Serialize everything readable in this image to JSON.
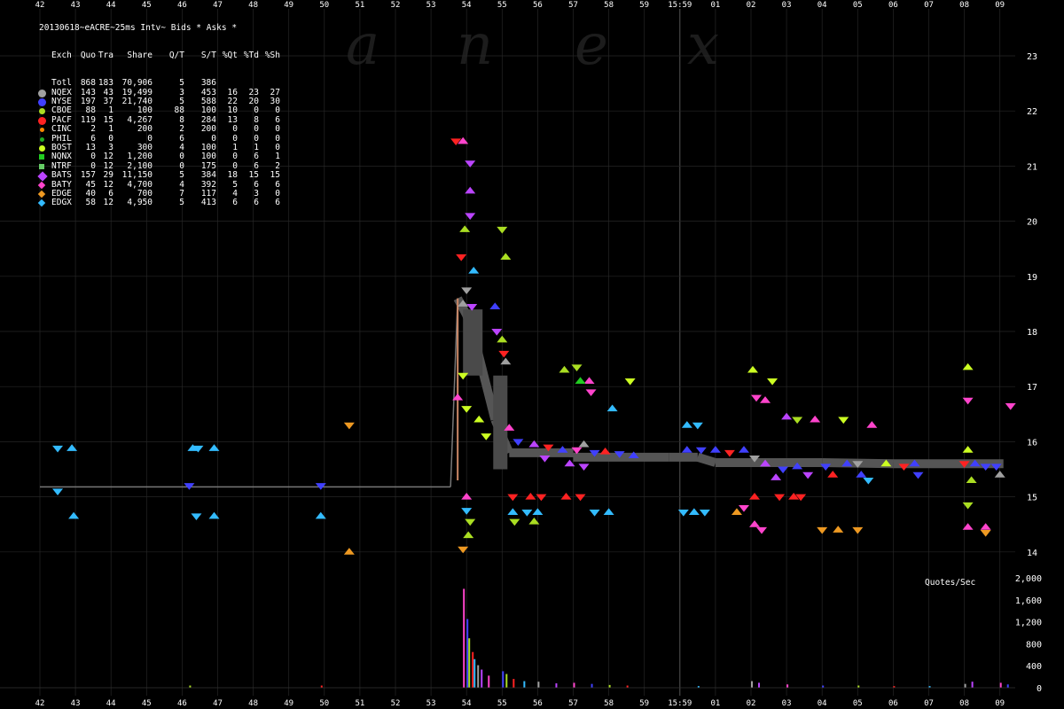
{
  "header": {
    "line1": "20130618~eACRE~25ms Intv~ Bids * Asks *",
    "columns": [
      "Exch",
      "Quo",
      "Tra",
      "Share",
      "Q/T",
      "S/T",
      "%Qt",
      "%Td",
      "%Sh"
    ]
  },
  "stats_rows": [
    {
      "exch": "Totl",
      "quo": "868",
      "tra": "183",
      "share": "70,906",
      "qt": "5",
      "st": "386",
      "pqt": "",
      "ptd": "",
      "psh": "",
      "color": "",
      "shape": "none"
    },
    {
      "exch": "NQEX",
      "quo": "143",
      "tra": "43",
      "share": "19,499",
      "qt": "3",
      "st": "453",
      "pqt": "16",
      "ptd": "23",
      "psh": "27",
      "color": "#a0a0a0",
      "shape": "hex"
    },
    {
      "exch": "NYSE",
      "quo": "197",
      "tra": "37",
      "share": "21,740",
      "qt": "5",
      "st": "588",
      "pqt": "22",
      "ptd": "20",
      "psh": "30",
      "color": "#4040ff",
      "shape": "hex"
    },
    {
      "exch": "CBOE",
      "quo": "88",
      "tra": "1",
      "share": "100",
      "qt": "88",
      "st": "100",
      "pqt": "10",
      "ptd": "0",
      "psh": "0",
      "color": "#aadd22",
      "shape": "dot"
    },
    {
      "exch": "PACF",
      "quo": "119",
      "tra": "15",
      "share": "4,267",
      "qt": "8",
      "st": "284",
      "pqt": "13",
      "ptd": "8",
      "psh": "6",
      "color": "#ff2222",
      "shape": "dotbig"
    },
    {
      "exch": "CINC",
      "quo": "2",
      "tra": "1",
      "share": "200",
      "qt": "2",
      "st": "200",
      "pqt": "0",
      "ptd": "0",
      "psh": "0",
      "color": "#ff8800",
      "shape": "dotsmall"
    },
    {
      "exch": "PHIL",
      "quo": "6",
      "tra": "0",
      "share": "0",
      "qt": "6",
      "st": "0",
      "pqt": "0",
      "ptd": "0",
      "psh": "0",
      "color": "#22aa22",
      "shape": "dotsmall"
    },
    {
      "exch": "BOST",
      "quo": "13",
      "tra": "3",
      "share": "300",
      "qt": "4",
      "st": "100",
      "pqt": "1",
      "ptd": "1",
      "psh": "0",
      "color": "#ccff22",
      "shape": "dot"
    },
    {
      "exch": "NQNX",
      "quo": "0",
      "tra": "12",
      "share": "1,200",
      "qt": "0",
      "st": "100",
      "pqt": "0",
      "ptd": "6",
      "psh": "1",
      "color": "#22cc22",
      "shape": "square"
    },
    {
      "exch": "NTRF",
      "quo": "0",
      "tra": "12",
      "share": "2,100",
      "qt": "0",
      "st": "175",
      "pqt": "0",
      "ptd": "6",
      "psh": "2",
      "color": "#66cc66",
      "shape": "square"
    },
    {
      "exch": "BATS",
      "quo": "157",
      "tra": "29",
      "share": "11,150",
      "qt": "5",
      "st": "384",
      "pqt": "18",
      "ptd": "15",
      "psh": "15",
      "color": "#bb44ff",
      "shape": "diamond"
    },
    {
      "exch": "BATY",
      "quo": "45",
      "tra": "12",
      "share": "4,700",
      "qt": "4",
      "st": "392",
      "pqt": "5",
      "ptd": "6",
      "psh": "6",
      "color": "#ff44cc",
      "shape": "diamondsmall"
    },
    {
      "exch": "EDGE",
      "quo": "40",
      "tra": "6",
      "share": "700",
      "qt": "7",
      "st": "117",
      "pqt": "4",
      "ptd": "3",
      "psh": "0",
      "color": "#ee9922",
      "shape": "diamondsmall"
    },
    {
      "exch": "EDGX",
      "quo": "58",
      "tra": "12",
      "share": "4,950",
      "qt": "5",
      "st": "413",
      "pqt": "6",
      "ptd": "6",
      "psh": "6",
      "color": "#33bbff",
      "shape": "diamondsmall"
    }
  ],
  "watermark": [
    "a",
    "n",
    "e",
    "x"
  ],
  "chart_data": {
    "type": "scatter",
    "x_ticks": [
      "42",
      "43",
      "44",
      "45",
      "46",
      "47",
      "48",
      "49",
      "50",
      "51",
      "52",
      "53",
      "54",
      "55",
      "56",
      "57",
      "58",
      "59",
      "15:59",
      "01",
      "02",
      "03",
      "04",
      "05",
      "06",
      "07",
      "08",
      "09"
    ],
    "y_ticks": [
      14,
      15,
      16,
      17,
      18,
      19,
      20,
      21,
      22,
      23
    ],
    "ylim": [
      13.6,
      23.8
    ],
    "volume_label": "Quotes/Sec",
    "volume_ticks": [
      0,
      400,
      800,
      1200,
      1600,
      2000
    ],
    "volume_ylim": [
      0,
      2100
    ],
    "nbbo": [
      {
        "x": 42.0,
        "y": 15.18
      },
      {
        "x": 53.55,
        "y": 15.18
      },
      {
        "x": 53.75,
        "y": 18.6
      },
      {
        "x": 54.0,
        "y": 18.3
      },
      {
        "x": 54.25,
        "y": 17.8
      },
      {
        "x": 54.8,
        "y": 16.4
      },
      {
        "x": 55.2,
        "y": 15.8
      },
      {
        "x": 57.0,
        "y": 15.8
      },
      {
        "x": 57.0,
        "y": 15.72
      },
      {
        "x": 59.7,
        "y": 15.72
      },
      {
        "x": 60.5,
        "y": 15.72
      },
      {
        "x": 61.0,
        "y": 15.62
      },
      {
        "x": 64.0,
        "y": 15.62
      },
      {
        "x": 66.0,
        "y": 15.6
      },
      {
        "x": 69.1,
        "y": 15.6
      }
    ],
    "quotes": [
      {
        "x": 42.5,
        "y": 15.88,
        "ex": "EDGX"
      },
      {
        "x": 42.9,
        "y": 15.88,
        "ex": "EDGX"
      },
      {
        "x": 42.5,
        "y": 15.1,
        "ex": "EDGX"
      },
      {
        "x": 42.95,
        "y": 14.65,
        "ex": "EDGX"
      },
      {
        "x": 46.2,
        "y": 15.2,
        "ex": "NYSE"
      },
      {
        "x": 46.3,
        "y": 15.88,
        "ex": "EDGX"
      },
      {
        "x": 46.45,
        "y": 15.88,
        "ex": "EDGX"
      },
      {
        "x": 46.9,
        "y": 15.88,
        "ex": "EDGX"
      },
      {
        "x": 46.4,
        "y": 14.65,
        "ex": "EDGX"
      },
      {
        "x": 46.9,
        "y": 14.65,
        "ex": "EDGX"
      },
      {
        "x": 49.9,
        "y": 15.2,
        "ex": "NYSE"
      },
      {
        "x": 49.9,
        "y": 14.65,
        "ex": "EDGX"
      },
      {
        "x": 50.7,
        "y": 16.3,
        "ex": "EDGE"
      },
      {
        "x": 50.7,
        "y": 14.0,
        "ex": "EDGE"
      },
      {
        "x": 53.7,
        "y": 21.45,
        "ex": "PACF"
      },
      {
        "x": 53.9,
        "y": 21.45,
        "ex": "BATY"
      },
      {
        "x": 54.1,
        "y": 21.05,
        "ex": "BATS"
      },
      {
        "x": 54.1,
        "y": 20.55,
        "ex": "BATS"
      },
      {
        "x": 54.1,
        "y": 20.1,
        "ex": "BATS"
      },
      {
        "x": 53.95,
        "y": 19.85,
        "ex": "CBOE"
      },
      {
        "x": 55.0,
        "y": 19.85,
        "ex": "CBOE"
      },
      {
        "x": 55.1,
        "y": 19.35,
        "ex": "CBOE"
      },
      {
        "x": 53.85,
        "y": 19.35,
        "ex": "PACF"
      },
      {
        "x": 54.2,
        "y": 19.1,
        "ex": "EDGX"
      },
      {
        "x": 54.0,
        "y": 18.75,
        "ex": "NQEX"
      },
      {
        "x": 53.9,
        "y": 18.5,
        "ex": "NQEX"
      },
      {
        "x": 54.15,
        "y": 18.45,
        "ex": "BATS"
      },
      {
        "x": 54.8,
        "y": 18.45,
        "ex": "NYSE"
      },
      {
        "x": 54.85,
        "y": 18.0,
        "ex": "BATS"
      },
      {
        "x": 55.0,
        "y": 17.85,
        "ex": "CBOE"
      },
      {
        "x": 55.05,
        "y": 17.6,
        "ex": "PACF"
      },
      {
        "x": 55.1,
        "y": 17.45,
        "ex": "NQEX"
      },
      {
        "x": 53.9,
        "y": 17.2,
        "ex": "BOST"
      },
      {
        "x": 53.75,
        "y": 16.8,
        "ex": "BATY"
      },
      {
        "x": 54.0,
        "y": 16.6,
        "ex": "BOST"
      },
      {
        "x": 54.35,
        "y": 16.4,
        "ex": "BOST"
      },
      {
        "x": 54.55,
        "y": 16.1,
        "ex": "BOST"
      },
      {
        "x": 55.2,
        "y": 16.25,
        "ex": "BATY"
      },
      {
        "x": 55.45,
        "y": 16.0,
        "ex": "NYSE"
      },
      {
        "x": 55.9,
        "y": 15.95,
        "ex": "BATS"
      },
      {
        "x": 56.3,
        "y": 15.9,
        "ex": "PACF"
      },
      {
        "x": 56.7,
        "y": 15.85,
        "ex": "NYSE"
      },
      {
        "x": 57.1,
        "y": 15.85,
        "ex": "BATY"
      },
      {
        "x": 57.3,
        "y": 15.95,
        "ex": "NQEX"
      },
      {
        "x": 57.6,
        "y": 15.8,
        "ex": "NYSE"
      },
      {
        "x": 57.9,
        "y": 15.82,
        "ex": "PACF"
      },
      {
        "x": 58.3,
        "y": 15.78,
        "ex": "NYSE"
      },
      {
        "x": 58.7,
        "y": 15.75,
        "ex": "NYSE"
      },
      {
        "x": 56.2,
        "y": 15.7,
        "ex": "BATS"
      },
      {
        "x": 56.9,
        "y": 15.6,
        "ex": "BATS"
      },
      {
        "x": 57.3,
        "y": 15.55,
        "ex": "BATS"
      },
      {
        "x": 56.75,
        "y": 17.3,
        "ex": "CBOE"
      },
      {
        "x": 57.1,
        "y": 17.35,
        "ex": "CBOE"
      },
      {
        "x": 57.45,
        "y": 17.1,
        "ex": "BATY"
      },
      {
        "x": 57.5,
        "y": 16.9,
        "ex": "BATY"
      },
      {
        "x": 58.1,
        "y": 16.6,
        "ex": "EDGX"
      },
      {
        "x": 58.6,
        "y": 17.1,
        "ex": "BOST"
      },
      {
        "x": 57.2,
        "y": 17.1,
        "ex": "NQNX"
      },
      {
        "x": 55.3,
        "y": 15.0,
        "ex": "PACF"
      },
      {
        "x": 55.8,
        "y": 15.0,
        "ex": "PACF"
      },
      {
        "x": 56.1,
        "y": 15.0,
        "ex": "PACF"
      },
      {
        "x": 56.8,
        "y": 15.0,
        "ex": "PACF"
      },
      {
        "x": 57.2,
        "y": 15.0,
        "ex": "PACF"
      },
      {
        "x": 55.3,
        "y": 14.72,
        "ex": "EDGX"
      },
      {
        "x": 55.7,
        "y": 14.72,
        "ex": "EDGX"
      },
      {
        "x": 56.0,
        "y": 14.72,
        "ex": "EDGX"
      },
      {
        "x": 57.6,
        "y": 14.72,
        "ex": "EDGX"
      },
      {
        "x": 58.0,
        "y": 14.72,
        "ex": "EDGX"
      },
      {
        "x": 55.35,
        "y": 14.55,
        "ex": "CBOE"
      },
      {
        "x": 55.9,
        "y": 14.55,
        "ex": "CBOE"
      },
      {
        "x": 54.1,
        "y": 14.55,
        "ex": "CBOE"
      },
      {
        "x": 54.05,
        "y": 14.3,
        "ex": "CBOE"
      },
      {
        "x": 53.9,
        "y": 14.05,
        "ex": "EDGE"
      },
      {
        "x": 54.0,
        "y": 15.0,
        "ex": "BATY"
      },
      {
        "x": 54.0,
        "y": 14.75,
        "ex": "EDGX"
      },
      {
        "x": 60.2,
        "y": 16.3,
        "ex": "EDGX"
      },
      {
        "x": 60.5,
        "y": 16.3,
        "ex": "EDGX"
      },
      {
        "x": 60.2,
        "y": 15.85,
        "ex": "NYSE"
      },
      {
        "x": 60.6,
        "y": 15.85,
        "ex": "NYSE"
      },
      {
        "x": 61.0,
        "y": 15.85,
        "ex": "NYSE"
      },
      {
        "x": 61.4,
        "y": 15.8,
        "ex": "PACF"
      },
      {
        "x": 61.8,
        "y": 15.85,
        "ex": "NYSE"
      },
      {
        "x": 62.1,
        "y": 15.7,
        "ex": "NQEX"
      },
      {
        "x": 62.4,
        "y": 15.6,
        "ex": "BATS"
      },
      {
        "x": 60.1,
        "y": 14.72,
        "ex": "EDGX"
      },
      {
        "x": 60.4,
        "y": 14.72,
        "ex": "EDGX"
      },
      {
        "x": 60.7,
        "y": 14.72,
        "ex": "EDGX"
      },
      {
        "x": 61.6,
        "y": 14.72,
        "ex": "EDGE"
      },
      {
        "x": 61.8,
        "y": 14.8,
        "ex": "BATY"
      },
      {
        "x": 62.05,
        "y": 17.3,
        "ex": "BOST"
      },
      {
        "x": 62.15,
        "y": 16.8,
        "ex": "BATY"
      },
      {
        "x": 62.4,
        "y": 16.75,
        "ex": "BATY"
      },
      {
        "x": 62.6,
        "y": 17.1,
        "ex": "BOST"
      },
      {
        "x": 63.0,
        "y": 16.45,
        "ex": "BATS"
      },
      {
        "x": 63.3,
        "y": 16.4,
        "ex": "CBOE"
      },
      {
        "x": 62.1,
        "y": 15.0,
        "ex": "PACF"
      },
      {
        "x": 62.8,
        "y": 15.0,
        "ex": "PACF"
      },
      {
        "x": 63.2,
        "y": 15.0,
        "ex": "PACF"
      },
      {
        "x": 63.4,
        "y": 15.0,
        "ex": "PACF"
      },
      {
        "x": 62.1,
        "y": 14.5,
        "ex": "BATY"
      },
      {
        "x": 62.3,
        "y": 14.4,
        "ex": "BATY"
      },
      {
        "x": 62.7,
        "y": 15.35,
        "ex": "BATS"
      },
      {
        "x": 62.9,
        "y": 15.5,
        "ex": "NYSE"
      },
      {
        "x": 63.3,
        "y": 15.55,
        "ex": "NYSE"
      },
      {
        "x": 63.6,
        "y": 15.4,
        "ex": "BATS"
      },
      {
        "x": 63.8,
        "y": 16.4,
        "ex": "BATY"
      },
      {
        "x": 64.1,
        "y": 15.55,
        "ex": "NYSE"
      },
      {
        "x": 64.3,
        "y": 15.4,
        "ex": "PACF"
      },
      {
        "x": 64.6,
        "y": 16.4,
        "ex": "BOST"
      },
      {
        "x": 64.7,
        "y": 15.6,
        "ex": "NYSE"
      },
      {
        "x": 65.0,
        "y": 15.6,
        "ex": "NQEX"
      },
      {
        "x": 65.1,
        "y": 15.4,
        "ex": "NYSE"
      },
      {
        "x": 64.0,
        "y": 14.4,
        "ex": "EDGE"
      },
      {
        "x": 64.45,
        "y": 14.4,
        "ex": "EDGE"
      },
      {
        "x": 65.0,
        "y": 14.4,
        "ex": "EDGE"
      },
      {
        "x": 65.4,
        "y": 16.3,
        "ex": "BATY"
      },
      {
        "x": 65.3,
        "y": 15.3,
        "ex": "EDGX"
      },
      {
        "x": 65.8,
        "y": 15.6,
        "ex": "BOST"
      },
      {
        "x": 66.3,
        "y": 15.55,
        "ex": "PACF"
      },
      {
        "x": 66.6,
        "y": 15.6,
        "ex": "NYSE"
      },
      {
        "x": 66.7,
        "y": 15.4,
        "ex": "NYSE"
      },
      {
        "x": 68.1,
        "y": 17.35,
        "ex": "BOST"
      },
      {
        "x": 68.1,
        "y": 16.75,
        "ex": "BATY"
      },
      {
        "x": 68.1,
        "y": 15.85,
        "ex": "BOST"
      },
      {
        "x": 68.0,
        "y": 15.6,
        "ex": "PACF"
      },
      {
        "x": 68.3,
        "y": 15.6,
        "ex": "NYSE"
      },
      {
        "x": 68.6,
        "y": 15.55,
        "ex": "NYSE"
      },
      {
        "x": 68.2,
        "y": 15.3,
        "ex": "CBOE"
      },
      {
        "x": 68.1,
        "y": 14.85,
        "ex": "CBOE"
      },
      {
        "x": 68.1,
        "y": 14.45,
        "ex": "BATY"
      },
      {
        "x": 68.6,
        "y": 14.35,
        "ex": "EDGE"
      },
      {
        "x": 68.6,
        "y": 14.45,
        "ex": "BATY"
      },
      {
        "x": 68.9,
        "y": 15.55,
        "ex": "NYSE"
      },
      {
        "x": 69.0,
        "y": 15.4,
        "ex": "NQEX"
      },
      {
        "x": 69.3,
        "y": 16.65,
        "ex": "BATY"
      }
    ],
    "volume_bursts": [
      {
        "x": 53.9,
        "v": 1800
      },
      {
        "x": 54.0,
        "v": 1250
      },
      {
        "x": 54.05,
        "v": 900
      },
      {
        "x": 54.15,
        "v": 650
      },
      {
        "x": 54.2,
        "v": 520
      },
      {
        "x": 54.3,
        "v": 410
      },
      {
        "x": 54.4,
        "v": 330
      },
      {
        "x": 54.6,
        "v": 220
      },
      {
        "x": 55.0,
        "v": 300
      },
      {
        "x": 55.1,
        "v": 250
      },
      {
        "x": 55.3,
        "v": 160
      },
      {
        "x": 55.6,
        "v": 120
      },
      {
        "x": 56.0,
        "v": 110
      },
      {
        "x": 56.5,
        "v": 80
      },
      {
        "x": 57.0,
        "v": 90
      },
      {
        "x": 57.5,
        "v": 70
      },
      {
        "x": 58.0,
        "v": 50
      },
      {
        "x": 58.5,
        "v": 40
      },
      {
        "x": 60.5,
        "v": 30
      },
      {
        "x": 62.0,
        "v": 120
      },
      {
        "x": 62.2,
        "v": 90
      },
      {
        "x": 63.0,
        "v": 60
      },
      {
        "x": 64.0,
        "v": 40
      },
      {
        "x": 65.0,
        "v": 40
      },
      {
        "x": 66.0,
        "v": 30
      },
      {
        "x": 67.0,
        "v": 30
      },
      {
        "x": 68.0,
        "v": 70
      },
      {
        "x": 68.2,
        "v": 110
      },
      {
        "x": 69.0,
        "v": 90
      },
      {
        "x": 69.2,
        "v": 60
      },
      {
        "x": 46.2,
        "v": 40
      },
      {
        "x": 49.9,
        "v": 40
      }
    ]
  }
}
